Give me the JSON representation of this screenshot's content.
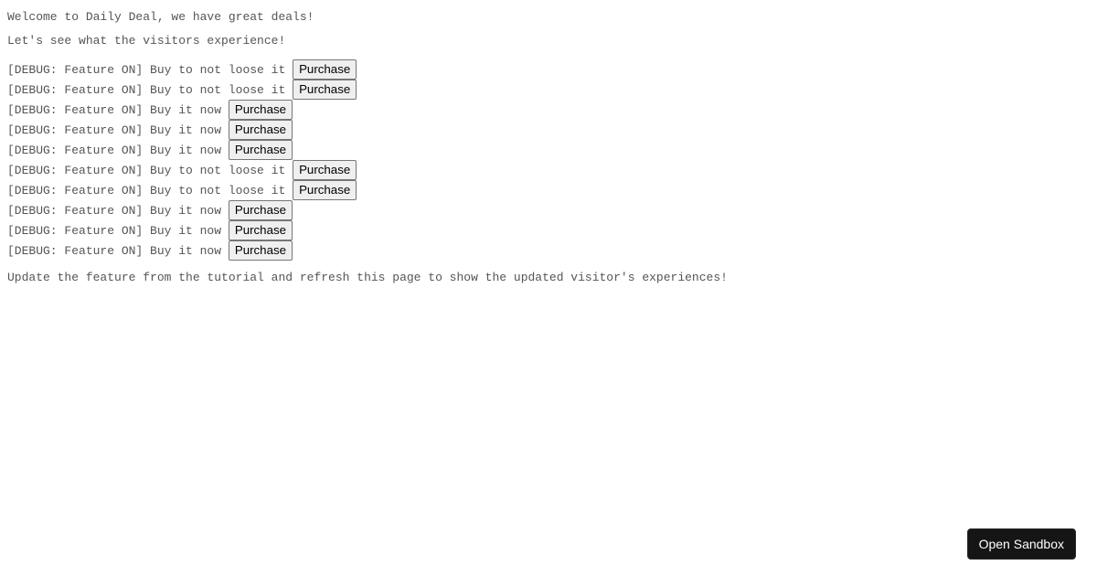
{
  "header": {
    "welcome": "Welcome to Daily Deal, we have great deals!",
    "subtitle": "Let's see what the visitors experience!"
  },
  "rows": [
    {
      "label": "[DEBUG: Feature ON] Buy to not loose it ",
      "button": "Purchase"
    },
    {
      "label": "[DEBUG: Feature ON] Buy to not loose it ",
      "button": "Purchase"
    },
    {
      "label": "[DEBUG: Feature ON] Buy it now ",
      "button": "Purchase"
    },
    {
      "label": "[DEBUG: Feature ON] Buy it now ",
      "button": "Purchase"
    },
    {
      "label": "[DEBUG: Feature ON] Buy it now ",
      "button": "Purchase"
    },
    {
      "label": "[DEBUG: Feature ON] Buy to not loose it ",
      "button": "Purchase"
    },
    {
      "label": "[DEBUG: Feature ON] Buy to not loose it ",
      "button": "Purchase"
    },
    {
      "label": "[DEBUG: Feature ON] Buy it now ",
      "button": "Purchase"
    },
    {
      "label": "[DEBUG: Feature ON] Buy it now ",
      "button": "Purchase"
    },
    {
      "label": "[DEBUG: Feature ON] Buy it now ",
      "button": "Purchase"
    }
  ],
  "footer": {
    "note": "Update the feature from the tutorial and refresh this page to show the updated visitor's experiences!"
  },
  "sandbox": {
    "label": "Open Sandbox"
  }
}
